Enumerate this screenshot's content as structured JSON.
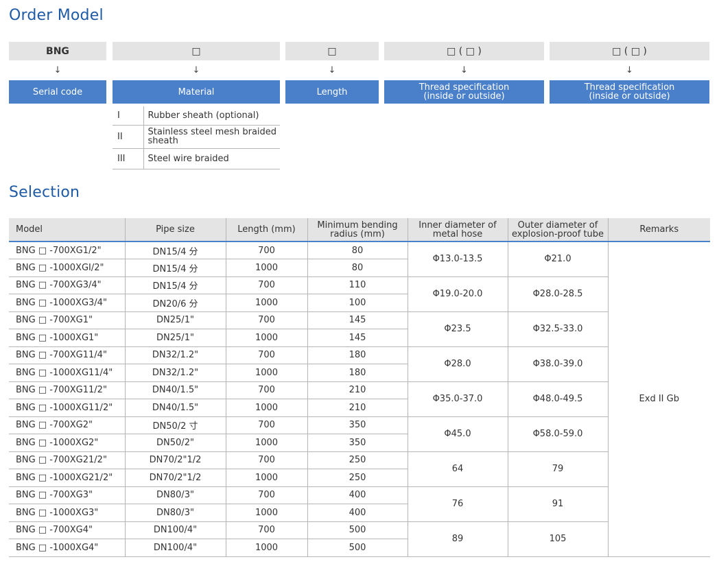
{
  "order_model": {
    "title": "Order Model",
    "columns": [
      {
        "code": "BNG",
        "arrow": "↓",
        "label": "Serial code"
      },
      {
        "code": "□",
        "arrow": "↓",
        "label": "Material"
      },
      {
        "code": "□",
        "arrow": "↓",
        "label": "Length"
      },
      {
        "code": "□ ( □ )",
        "arrow": "↓",
        "label": "Thread specification\n(inside or outside)"
      },
      {
        "code": "□ ( □ )",
        "arrow": "↓",
        "label": "Thread specification\n(inside or outside)"
      }
    ],
    "materials": [
      {
        "key": "I",
        "value": "Rubber sheath (optional)"
      },
      {
        "key": "II",
        "value": "Stainless steel mesh braided sheath"
      },
      {
        "key": "III",
        "value": "Steel wire braided"
      }
    ]
  },
  "selection": {
    "title": "Selection",
    "headers": [
      "Model",
      "Pipe size",
      "Length (mm)",
      "Minimum bending radius (mm)",
      "Inner diameter of metal hose",
      "Outer diameter of explosion-proof tube",
      "Remarks"
    ],
    "remarks": "Exd II Gb",
    "groups": [
      {
        "inner": "Φ13.0-13.5",
        "outer": "Φ21.0",
        "rows": [
          {
            "model": "BNG □ -700XG1/2\"",
            "pipe": "DN15/4 分",
            "length": "700",
            "radius": "80"
          },
          {
            "model": "BNG □ -1000XGI/2\"",
            "pipe": "DN15/4 分",
            "length": "1000",
            "radius": "80"
          }
        ]
      },
      {
        "inner": "Φ19.0-20.0",
        "outer": "Φ28.0-28.5",
        "rows": [
          {
            "model": "BNG □ -700XG3/4\"",
            "pipe": "DN15/4 分",
            "length": "700",
            "radius": "110"
          },
          {
            "model": "BNG □ -1000XG3/4\"",
            "pipe": "DN20/6 分",
            "length": "1000",
            "radius": "100"
          }
        ]
      },
      {
        "inner": "Φ23.5",
        "outer": "Φ32.5-33.0",
        "rows": [
          {
            "model": "BNG □ -700XG1\"",
            "pipe": "DN25/1\"",
            "length": "700",
            "radius": "145"
          },
          {
            "model": "BNG □ -1000XG1\"",
            "pipe": "DN25/1\"",
            "length": "1000",
            "radius": "145"
          }
        ]
      },
      {
        "inner": "Φ28.0",
        "outer": "Φ38.0-39.0",
        "rows": [
          {
            "model": "BNG □ -700XG11/4\"",
            "pipe": "DN32/1.2\"",
            "length": "700",
            "radius": "180"
          },
          {
            "model": "BNG □ -1000XG11/4\"",
            "pipe": "DN32/1.2\"",
            "length": "1000",
            "radius": "180"
          }
        ]
      },
      {
        "inner": "Φ35.0-37.0",
        "outer": "Φ48.0-49.5",
        "rows": [
          {
            "model": "BNG □ -700XG11/2\"",
            "pipe": "DN40/1.5\"",
            "length": "700",
            "radius": "210"
          },
          {
            "model": "BNG □ -1000XG11/2\"",
            "pipe": "DN40/1.5\"",
            "length": "1000",
            "radius": "210"
          }
        ]
      },
      {
        "inner": "Φ45.0",
        "outer": "Φ58.0-59.0",
        "rows": [
          {
            "model": "BNG □ -700XG2\"",
            "pipe": "DN50/2 寸",
            "length": "700",
            "radius": "350"
          },
          {
            "model": "BNG □ -1000XG2\"",
            "pipe": "DN50/2\"",
            "length": "1000",
            "radius": "350"
          }
        ]
      },
      {
        "inner": "64",
        "outer": "79",
        "rows": [
          {
            "model": "BNG □ -700XG21/2\"",
            "pipe": "DN70/2\"1/2",
            "length": "700",
            "radius": "250"
          },
          {
            "model": "BNG □ -1000XG21/2\"",
            "pipe": "DN70/2\"1/2",
            "length": "1000",
            "radius": "250"
          }
        ]
      },
      {
        "inner": "76",
        "outer": "91",
        "rows": [
          {
            "model": "BNG □ -700XG3\"",
            "pipe": "DN80/3\"",
            "length": "700",
            "radius": "400"
          },
          {
            "model": "BNG □ -1000XG3\"",
            "pipe": "DN80/3\"",
            "length": "1000",
            "radius": "400"
          }
        ]
      },
      {
        "inner": "89",
        "outer": "105",
        "rows": [
          {
            "model": "BNG □ -700XG4\"",
            "pipe": "DN100/4\"",
            "length": "700",
            "radius": "500"
          },
          {
            "model": "BNG □ -1000XG4\"",
            "pipe": "DN100/4\"",
            "length": "1000",
            "radius": "500"
          }
        ]
      }
    ]
  }
}
